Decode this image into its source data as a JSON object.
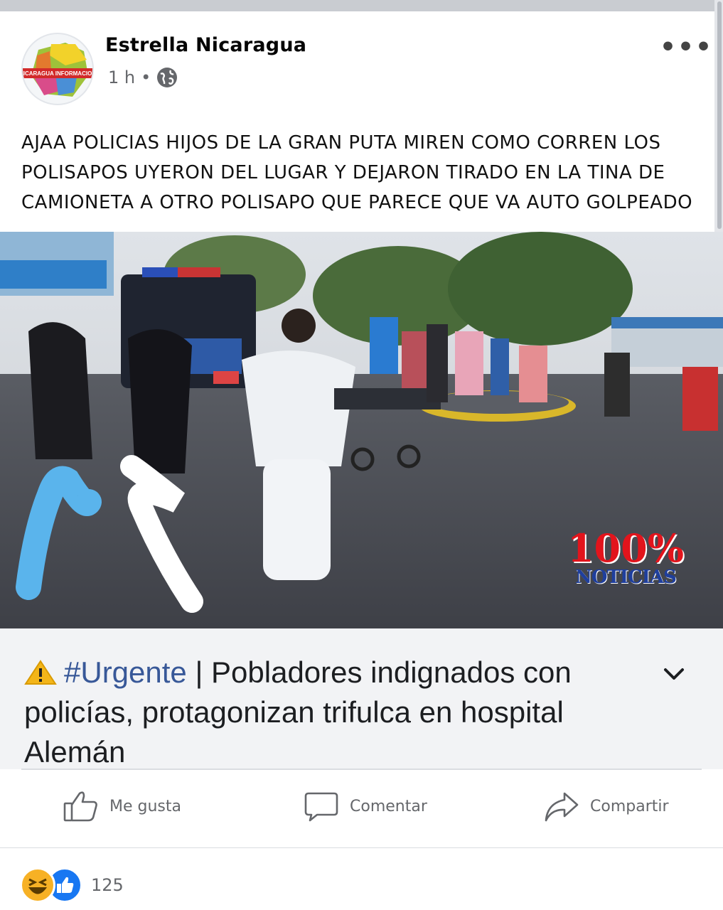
{
  "post": {
    "author": "Estrella Nicaragua",
    "time": "1 h",
    "separator": "•",
    "avatar_label": "NICARAGUA INFORMACION",
    "text": "AJAA POLICIAS HIJOS DE LA GRAN PUTA MIREN COMO CORREN LOS POLISAPOS UYERON DEL LUGAR Y DEJARON TIRADO EN LA TINA DE CAMIONETA A OTRO POLISAPO QUE PARECE QUE VA AUTO GOLPEADO",
    "more_label": "•••"
  },
  "photo": {
    "watermark_top": "100%",
    "watermark_bottom": "NOTICIAS"
  },
  "link": {
    "hashtag": "#Urgente",
    "headline": " | Pobladores indignados con policías, protagonizan trifulca en hospital Alemán"
  },
  "actions": {
    "like": "Me gusta",
    "comment": "Comentar",
    "share": "Compartir"
  },
  "reactions": {
    "count": "125",
    "types": [
      "haha",
      "like"
    ]
  },
  "colors": {
    "link_blue": "#385898",
    "like_blue": "#1877f2",
    "haha_yellow": "#f7b125",
    "muted": "#65676b"
  }
}
